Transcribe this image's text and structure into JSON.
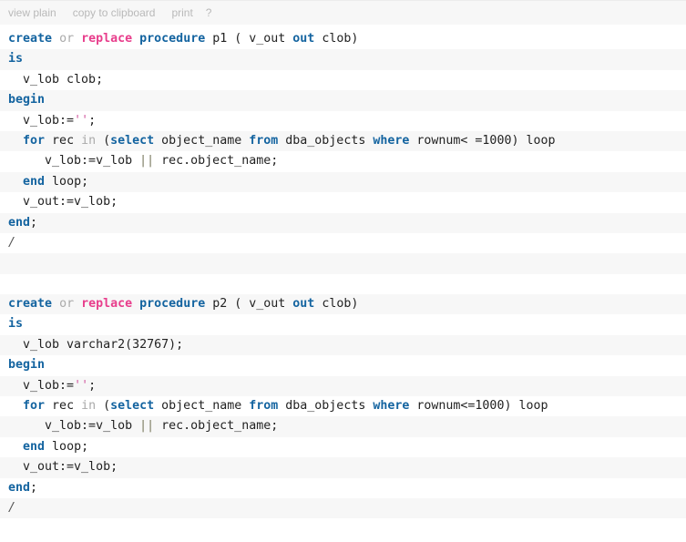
{
  "toolbar": {
    "items": [
      {
        "name": "view-plain",
        "label": "view plain"
      },
      {
        "name": "copy-to-clipboard",
        "label": "copy to clipboard"
      },
      {
        "name": "print",
        "label": "print"
      },
      {
        "name": "help",
        "label": "?"
      }
    ]
  },
  "colors": {
    "keyword": "#1464a0",
    "keyword_soft": "#aaaaaa",
    "keyword_replace": "#e83e8c",
    "string": "#d15ba0",
    "operator": "#9a9a86",
    "plain": "#222222",
    "row_alt_bg": "#f7f7f7",
    "row_bg": "#ffffff",
    "toolbar_bg": "#f7f7f7",
    "toolbar_text": "#b9b9b9"
  },
  "code": {
    "language": "plsql",
    "lines": [
      [
        {
          "t": "create",
          "c": "kw"
        },
        {
          "t": " ",
          "c": "pl"
        },
        {
          "t": "or",
          "c": "kw2"
        },
        {
          "t": " ",
          "c": "pl"
        },
        {
          "t": "replace",
          "c": "kw3"
        },
        {
          "t": " ",
          "c": "pl"
        },
        {
          "t": "procedure",
          "c": "kw"
        },
        {
          "t": " p1 ( v_out ",
          "c": "pl"
        },
        {
          "t": "out",
          "c": "kw"
        },
        {
          "t": " clob)",
          "c": "pl"
        }
      ],
      [
        {
          "t": "is",
          "c": "kw"
        }
      ],
      [
        {
          "t": "  v_lob clob;",
          "c": "pl"
        }
      ],
      [
        {
          "t": "begin",
          "c": "kw"
        }
      ],
      [
        {
          "t": "  v_lob:=",
          "c": "pl"
        },
        {
          "t": "''",
          "c": "str"
        },
        {
          "t": ";",
          "c": "pl"
        }
      ],
      [
        {
          "t": "  ",
          "c": "pl"
        },
        {
          "t": "for",
          "c": "kw"
        },
        {
          "t": " rec ",
          "c": "pl"
        },
        {
          "t": "in",
          "c": "kw2"
        },
        {
          "t": " (",
          "c": "pl"
        },
        {
          "t": "select",
          "c": "kw"
        },
        {
          "t": " object_name ",
          "c": "pl"
        },
        {
          "t": "from",
          "c": "kw"
        },
        {
          "t": " dba_objects ",
          "c": "pl"
        },
        {
          "t": "where",
          "c": "kw"
        },
        {
          "t": " rownum< =1000) loop",
          "c": "pl"
        }
      ],
      [
        {
          "t": "     v_lob:=v_lob ",
          "c": "pl"
        },
        {
          "t": "||",
          "c": "op"
        },
        {
          "t": " rec.object_name;",
          "c": "pl"
        }
      ],
      [
        {
          "t": "  ",
          "c": "pl"
        },
        {
          "t": "end",
          "c": "kw"
        },
        {
          "t": " loop;",
          "c": "pl"
        }
      ],
      [
        {
          "t": "  v_out:=v_lob;",
          "c": "pl"
        }
      ],
      [
        {
          "t": "end",
          "c": "kw"
        },
        {
          "t": ";",
          "c": "pl"
        }
      ],
      [
        {
          "t": "/",
          "c": "sl"
        }
      ],
      [
        {
          "t": " ",
          "c": "pl"
        }
      ],
      [
        {
          "t": " ",
          "c": "pl"
        }
      ],
      [
        {
          "t": "create",
          "c": "kw"
        },
        {
          "t": " ",
          "c": "pl"
        },
        {
          "t": "or",
          "c": "kw2"
        },
        {
          "t": " ",
          "c": "pl"
        },
        {
          "t": "replace",
          "c": "kw3"
        },
        {
          "t": " ",
          "c": "pl"
        },
        {
          "t": "procedure",
          "c": "kw"
        },
        {
          "t": " p2 ( v_out ",
          "c": "pl"
        },
        {
          "t": "out",
          "c": "kw"
        },
        {
          "t": " clob)",
          "c": "pl"
        }
      ],
      [
        {
          "t": "is",
          "c": "kw"
        }
      ],
      [
        {
          "t": "  v_lob varchar2(32767);",
          "c": "pl"
        }
      ],
      [
        {
          "t": "begin",
          "c": "kw"
        }
      ],
      [
        {
          "t": "  v_lob:=",
          "c": "pl"
        },
        {
          "t": "''",
          "c": "str"
        },
        {
          "t": ";",
          "c": "pl"
        }
      ],
      [
        {
          "t": "  ",
          "c": "pl"
        },
        {
          "t": "for",
          "c": "kw"
        },
        {
          "t": " rec ",
          "c": "pl"
        },
        {
          "t": "in",
          "c": "kw2"
        },
        {
          "t": " (",
          "c": "pl"
        },
        {
          "t": "select",
          "c": "kw"
        },
        {
          "t": " object_name ",
          "c": "pl"
        },
        {
          "t": "from",
          "c": "kw"
        },
        {
          "t": " dba_objects ",
          "c": "pl"
        },
        {
          "t": "where",
          "c": "kw"
        },
        {
          "t": " rownum<=1000) loop",
          "c": "pl"
        }
      ],
      [
        {
          "t": "     v_lob:=v_lob ",
          "c": "pl"
        },
        {
          "t": "||",
          "c": "op"
        },
        {
          "t": " rec.object_name;",
          "c": "pl"
        }
      ],
      [
        {
          "t": "  ",
          "c": "pl"
        },
        {
          "t": "end",
          "c": "kw"
        },
        {
          "t": " loop;",
          "c": "pl"
        }
      ],
      [
        {
          "t": "  v_out:=v_lob;",
          "c": "pl"
        }
      ],
      [
        {
          "t": "end",
          "c": "kw"
        },
        {
          "t": ";",
          "c": "pl"
        }
      ],
      [
        {
          "t": "/",
          "c": "sl"
        }
      ]
    ]
  }
}
